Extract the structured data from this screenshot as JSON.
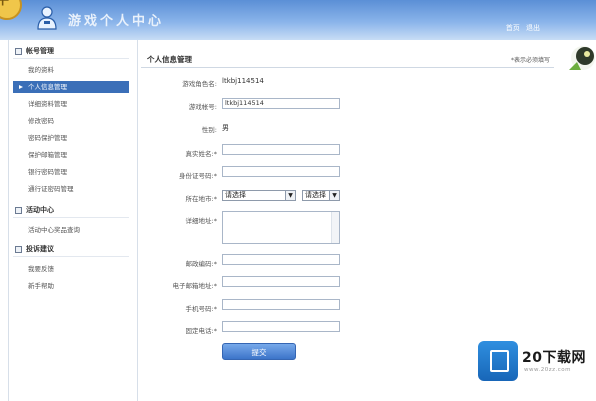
{
  "banner": {
    "title": "游戏个人中心",
    "deco_char": "牛"
  },
  "top_links": [
    "首页",
    "退出"
  ],
  "sidebar": {
    "sections": [
      {
        "title": "帐号管理",
        "items": [
          "我的资料",
          "个人信息管理",
          "详细资料管理",
          "修改密码",
          "密码保护管理",
          "保护邮箱管理",
          "银行密码管理",
          "通行证密码管理"
        ]
      },
      {
        "title": "活动中心",
        "items": [
          "活动中心奖品查询"
        ]
      },
      {
        "title": "投诉建议",
        "items": [
          "我要反馈",
          "新手帮助"
        ]
      }
    ],
    "active_index": 1
  },
  "main": {
    "title": "个人信息管理",
    "hint": "*表示必须填写",
    "fields": {
      "nickname": {
        "label": "游戏角色名:",
        "value": "ltkbj114514"
      },
      "account": {
        "label": "游戏帐号:",
        "value": "ltkbj114514"
      },
      "gender": {
        "label": "性别:",
        "value": "男"
      },
      "realname": {
        "label": "真实姓名:*",
        "value": ""
      },
      "idcard": {
        "label": "身份证号码:*",
        "value": ""
      },
      "region": {
        "label": "所在地市:*",
        "province": "请选择",
        "city": "请选择"
      },
      "address": {
        "label": "详细地址:*",
        "value": ""
      },
      "postcode": {
        "label": "邮政编码:*",
        "value": ""
      },
      "email": {
        "label": "电子邮箱地址:*",
        "value": ""
      },
      "mobile": {
        "label": "手机号码:*",
        "value": ""
      },
      "phone": {
        "label": "固定电话:*",
        "value": ""
      }
    },
    "submit_label": "提交"
  },
  "watermark": {
    "brand": "20下载网",
    "url": "www.20zz.com",
    "color": "#1e74cc"
  }
}
